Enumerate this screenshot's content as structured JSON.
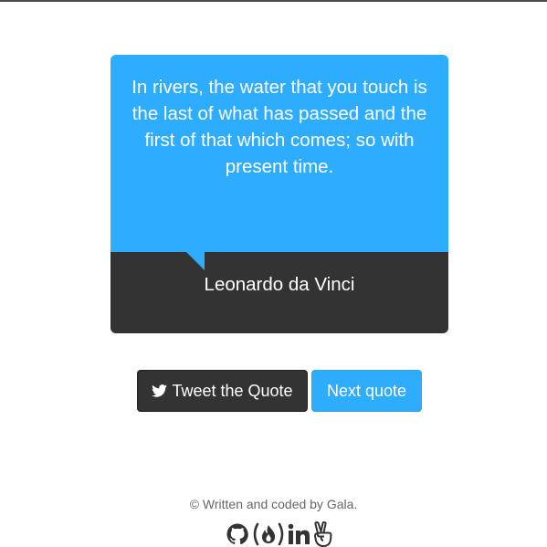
{
  "quote": {
    "text": "In rivers, the water that you touch is the last of what has passed and the first of that which comes; so with present time.",
    "author": "Leonardo da Vinci"
  },
  "buttons": {
    "tweet_label": "Tweet the Quote",
    "next_label": "Next quote"
  },
  "footer": {
    "credit": "© Written and coded by Gala.",
    "icons": [
      "github-icon",
      "freecodecamp-icon",
      "linkedin-icon",
      "angellist-icon"
    ]
  },
  "colors": {
    "accent_blue": "#2eacfd",
    "dark": "#333333",
    "text_muted": "#666666"
  }
}
